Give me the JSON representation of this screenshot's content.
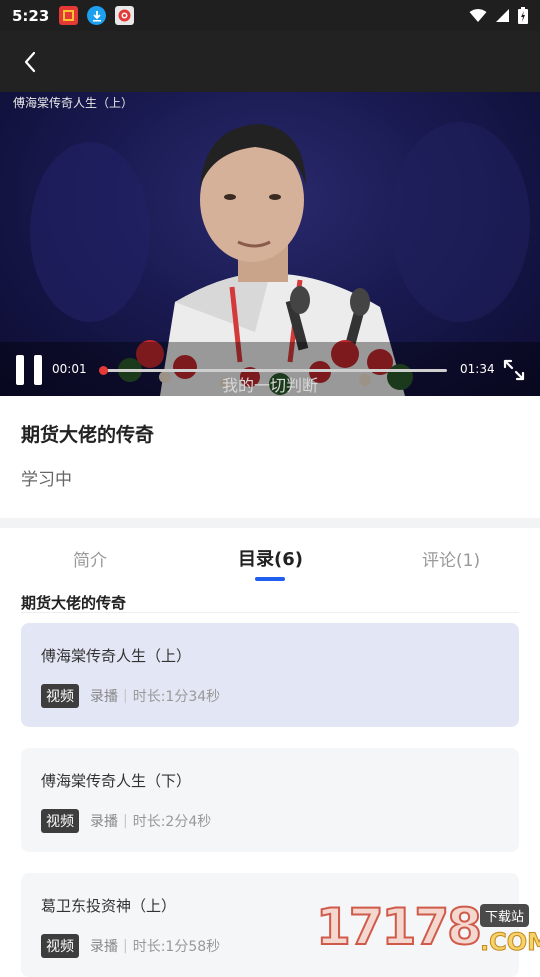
{
  "status_bar": {
    "time": "5:23"
  },
  "video": {
    "title": "傅海棠传奇人生（上）",
    "subtitle": "我的一切判断",
    "current_time": "00:01",
    "total_time": "01:34",
    "progress_fraction": 0.01
  },
  "course": {
    "title": "期货大佬的传奇",
    "status": "学习中"
  },
  "tabs": [
    {
      "label": "简介"
    },
    {
      "label": "目录(6)"
    },
    {
      "label": "评论(1)"
    }
  ],
  "section_title": "期货大佬的传奇",
  "lessons": [
    {
      "name": "傅海棠传奇人生（上）",
      "tag": "视频",
      "kind": "录播",
      "duration": "时长:1分34秒"
    },
    {
      "name": "傅海棠传奇人生（下）",
      "tag": "视频",
      "kind": "录播",
      "duration": "时长:2分4秒"
    },
    {
      "name": "葛卫东投资神（上）",
      "tag": "视频",
      "kind": "录播",
      "duration": "时长:1分58秒"
    }
  ],
  "watermark": {
    "number": "17178",
    "badge": "下载站",
    "suffix": ".COM"
  },
  "colors": {
    "accent": "#1e5ff0",
    "progress": "#e53935",
    "active_lesson_bg": "#e3e6f5"
  }
}
